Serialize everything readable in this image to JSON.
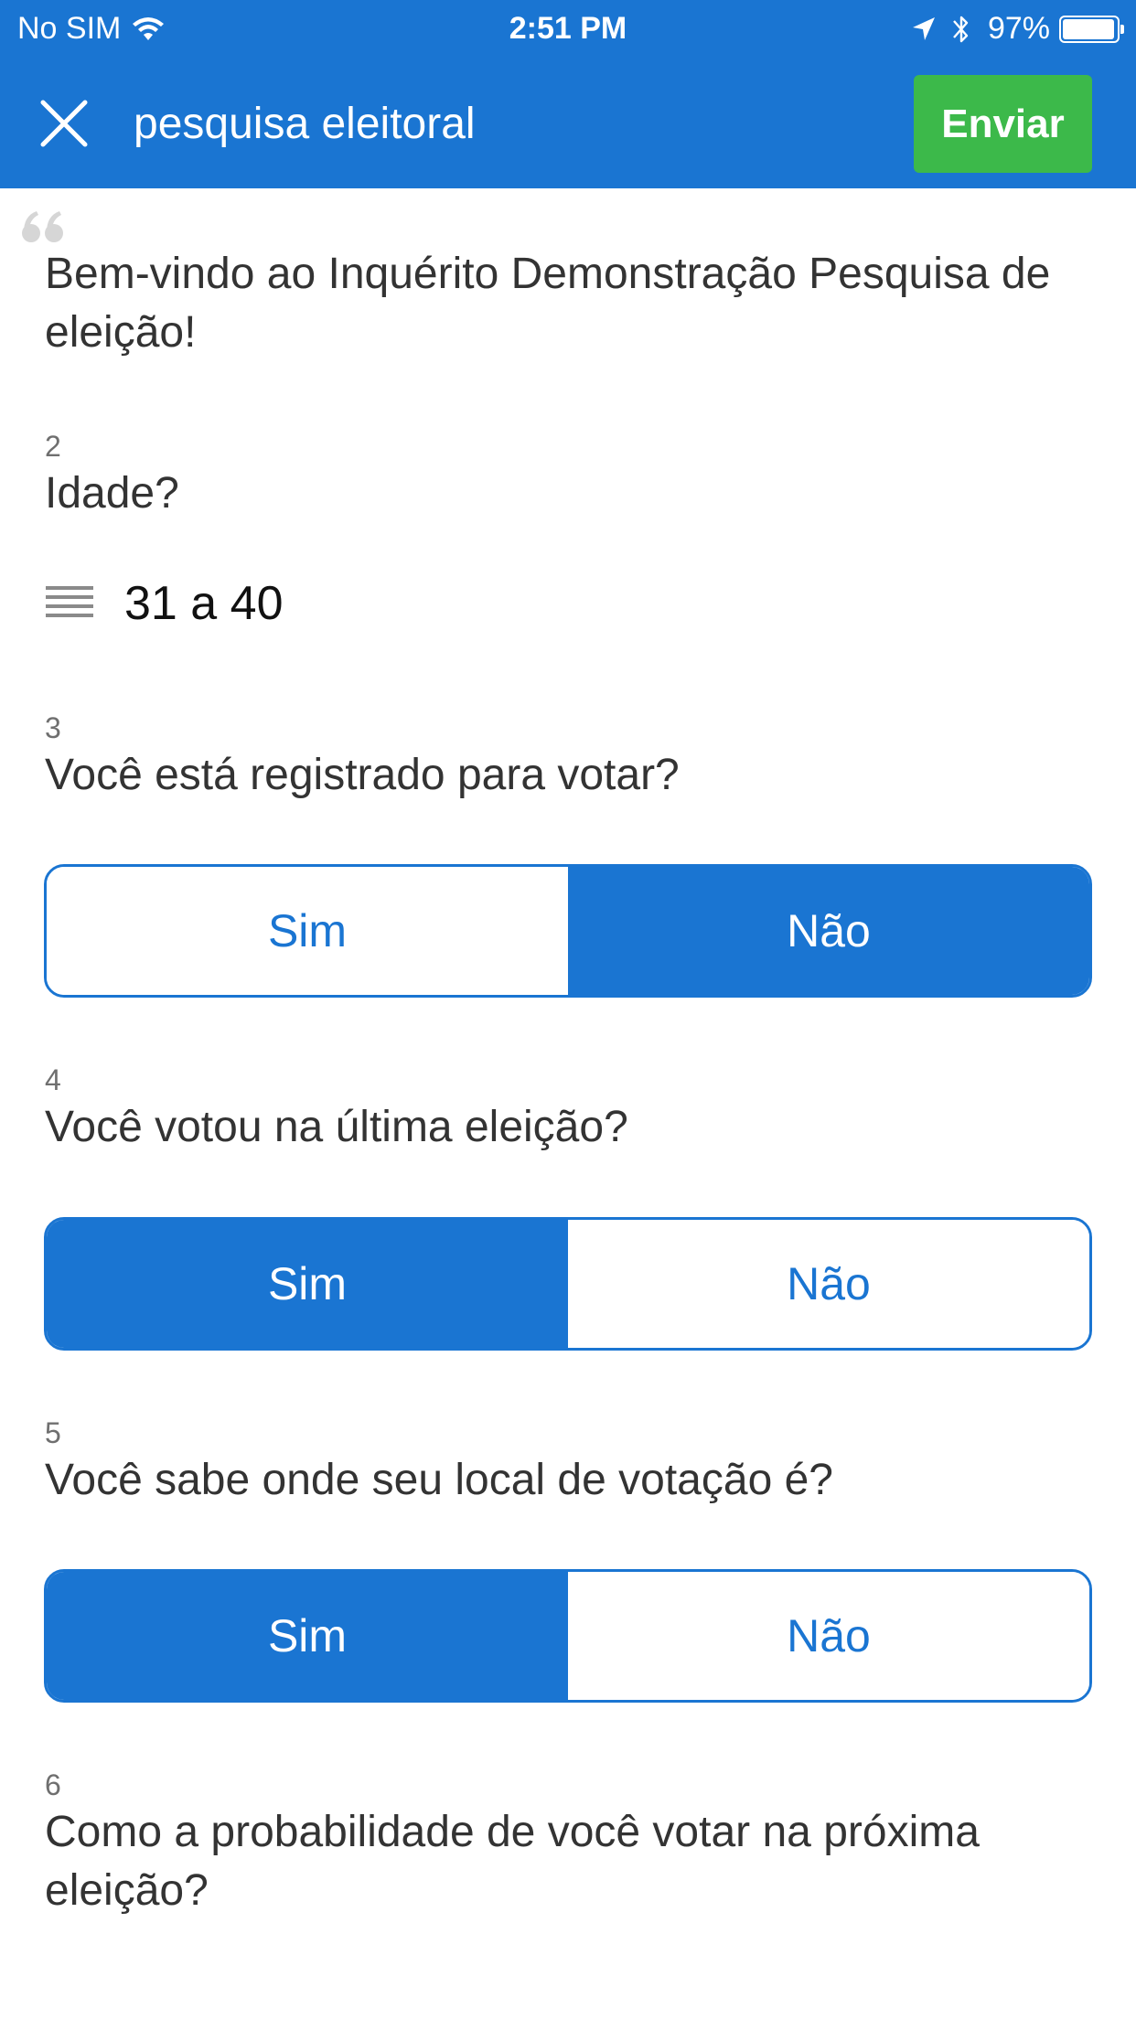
{
  "status_bar": {
    "carrier": "No SIM",
    "time": "2:51 PM",
    "battery_percent": "97%",
    "battery_level": 0.97
  },
  "nav": {
    "title": "pesquisa eleitoral",
    "send_label": "Enviar"
  },
  "colors": {
    "primary": "#1a75d2",
    "send_button": "#3cb94a",
    "text": "#333333"
  },
  "intro": {
    "text": "Bem-vindo ao Inquérito Demonstração Pesquisa de eleição!"
  },
  "questions": [
    {
      "number": "2",
      "text": "Idade?",
      "selected_value": "31 a 40"
    },
    {
      "number": "3",
      "text": "Você está registrado para votar?",
      "options": [
        "Sim",
        "Não"
      ],
      "selected": "Não"
    },
    {
      "number": "4",
      "text": "Você votou na última eleição?",
      "options": [
        "Sim",
        "Não"
      ],
      "selected": "Sim"
    },
    {
      "number": "5",
      "text": "Você sabe onde seu local de votação é?",
      "options": [
        "Sim",
        "Não"
      ],
      "selected": "Sim"
    },
    {
      "number": "6",
      "text": "Como a probabilidade de você votar na próxima eleição?"
    }
  ]
}
